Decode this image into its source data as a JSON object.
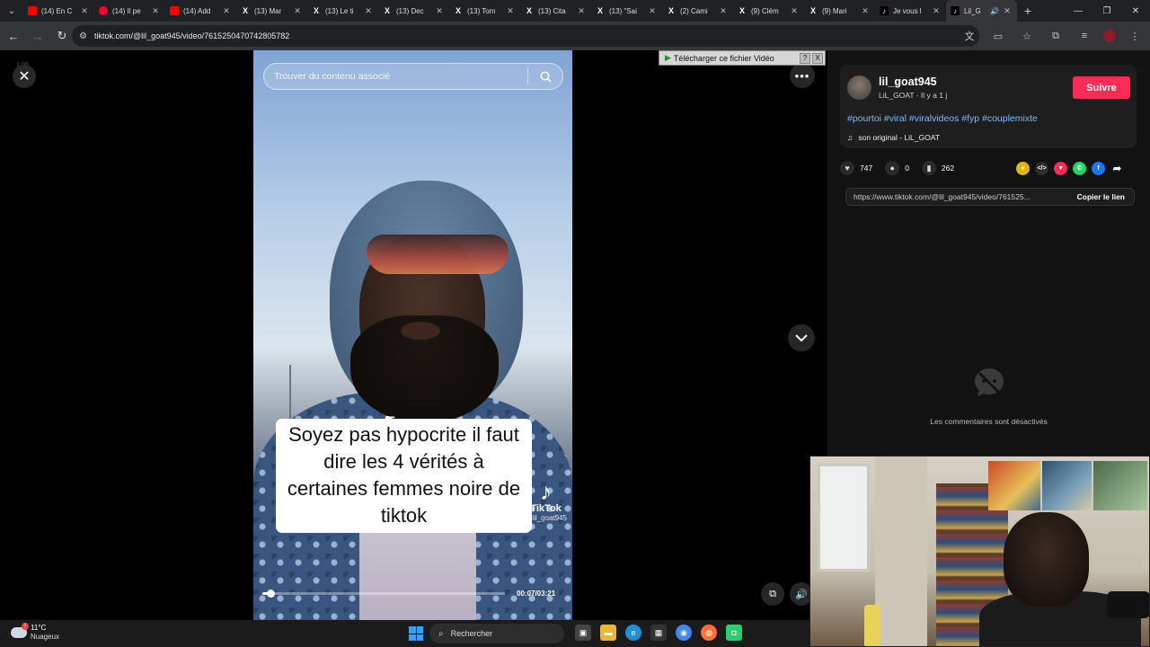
{
  "browser": {
    "tabs": [
      {
        "label": "(14) En C",
        "favicon": "youtube-icon"
      },
      {
        "label": "(14) Il pe",
        "favicon": "youtube-live-icon"
      },
      {
        "label": "(14) Add",
        "favicon": "youtube-icon"
      },
      {
        "label": "(13) Mar",
        "favicon": "x-icon"
      },
      {
        "label": "(13) Le ti",
        "favicon": "x-icon"
      },
      {
        "label": "(13) Dec",
        "favicon": "x-icon"
      },
      {
        "label": "(13) Tom",
        "favicon": "x-icon"
      },
      {
        "label": "(13) Cita",
        "favicon": "x-icon"
      },
      {
        "label": "(13) \"Sai",
        "favicon": "x-icon"
      },
      {
        "label": "(2) Cami",
        "favicon": "x-icon"
      },
      {
        "label": "(9) Clém",
        "favicon": "x-icon"
      },
      {
        "label": "(9) Mari",
        "favicon": "x-icon"
      },
      {
        "label": "Je vous l",
        "favicon": "tiktok-icon"
      },
      {
        "label": "Lil_G",
        "favicon": "tiktok-icon",
        "active": true
      }
    ],
    "url": "tiktok.com/@lil_goat945/video/7615250470742805782"
  },
  "player": {
    "counter": "1:00",
    "search_placeholder": "Trouver du contenu associé",
    "caption": "Soyez pas hypocrite il faut dire les 4 vérités à certaines femmes noire de tiktok",
    "watermark_brand": "TikTok",
    "watermark_handle": "@lil_goat945",
    "time": "00:07/03:21",
    "progress_fraction": 0.035
  },
  "download_bar": {
    "label": "Télécharger ce fichier Vidéo",
    "help": "?",
    "close": "X"
  },
  "post": {
    "username": "lil_goat945",
    "subline": "LiL_GOAT · Il y a 1 j",
    "follow_label": "Suivre",
    "hashtags": "#pourtoi #viral #viralvideos #fyp #couplemixte",
    "music": "son original - LiL_GOAT",
    "likes": "747",
    "comments": "0",
    "saves": "262",
    "link": "https://www.tiktok.com/@lil_goat945/video/761525...",
    "copy_label": "Copier le lien",
    "comments_disabled": "Les commentaires sont désactivés"
  },
  "taskbar": {
    "temperature": "11°C",
    "condition": "Nuageux",
    "search_label": "Rechercher"
  },
  "colors": {
    "follow": "#fe2c55",
    "hashtag": "#7fb8ff",
    "panel_bg": "#121212"
  }
}
